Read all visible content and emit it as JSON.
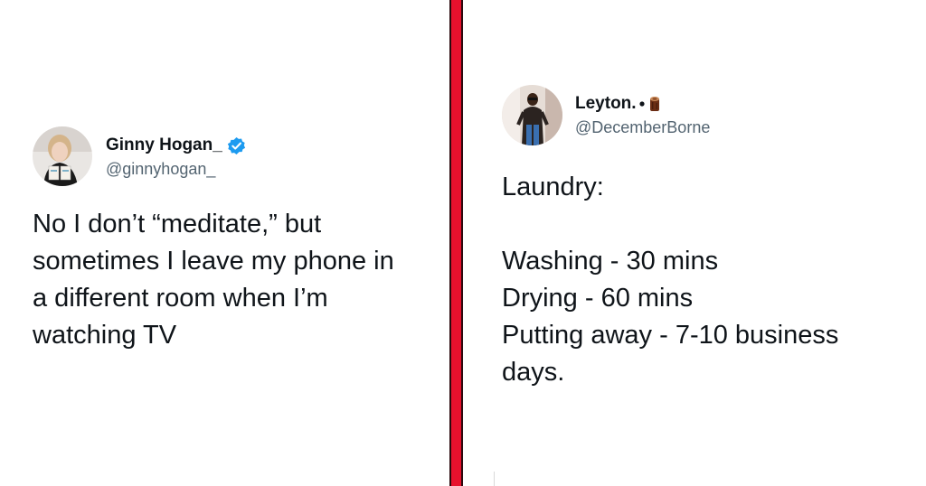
{
  "left_tweet": {
    "display_name": "Ginny Hogan_",
    "handle": "@ginnyhogan_",
    "text": "No I don’t “meditate,” but\nsometimes I leave my phone in\na different room when I’m\nwatching TV",
    "verified_icon": "verified-badge-icon",
    "accent_color": "#1d9bf0"
  },
  "right_tweet": {
    "display_name": "Leyton.",
    "handle": "@DecemberBorne",
    "text": "Laundry:\n\nWashing - 30 mins\nDrying - 60 mins\nPutting away - 7-10 business\ndays.",
    "name_decoration_icons": [
      "dot-icon",
      "log-emoji-icon"
    ]
  },
  "divider": {
    "color": "#e8112d"
  }
}
